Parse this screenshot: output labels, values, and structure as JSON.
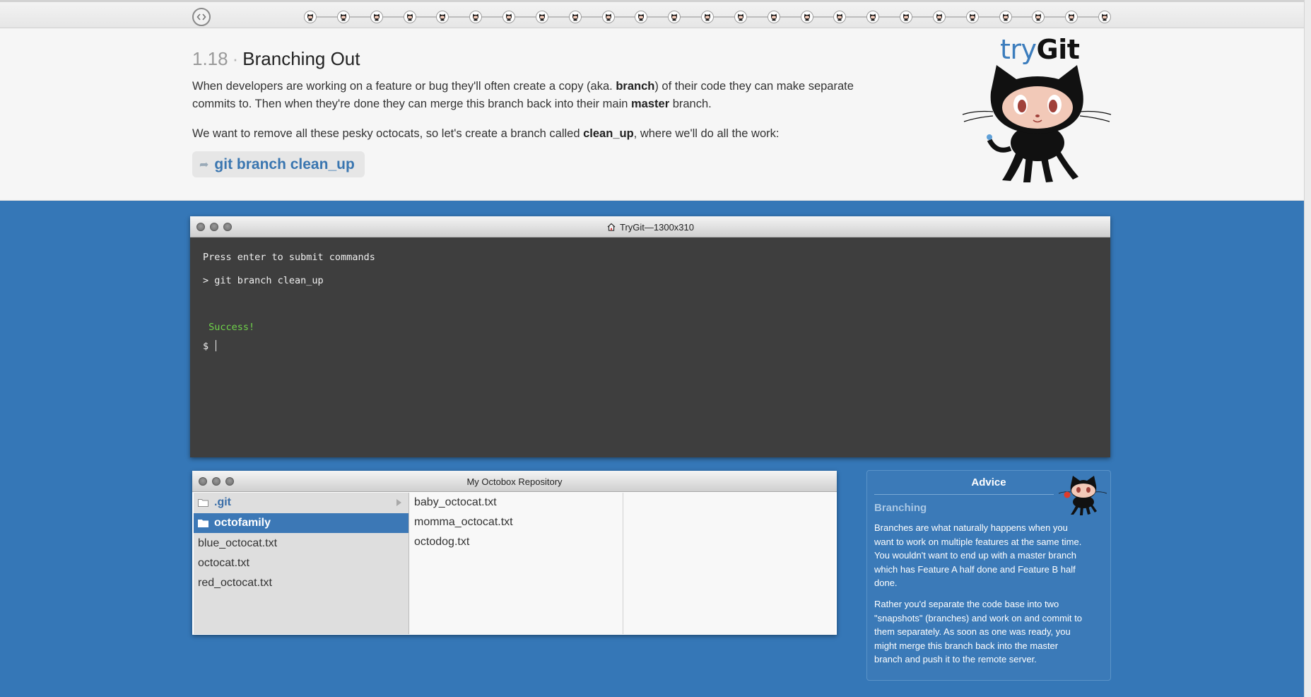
{
  "progress": {
    "total_steps": 25,
    "nav_icon": "code-brackets-icon",
    "step_icon": "octocat-icon"
  },
  "lesson": {
    "number": "1.18",
    "separator": "·",
    "title": "Branching Out",
    "para1": {
      "t1": "When developers are working on a feature or bug they'll often create a copy (aka. ",
      "b1": "branch",
      "t2": ") of their code they can make separate commits to. Then when they're done they can merge this branch back into their main ",
      "b2": "master",
      "t3": " branch."
    },
    "para2": {
      "t1": "We want to remove all these pesky octocats, so let's create a branch called ",
      "b1": "clean_up",
      "t2": ", where we'll do all the work:"
    },
    "command": "git branch clean_up"
  },
  "logo": {
    "try": "try",
    "git": "Git"
  },
  "terminal": {
    "title": "TryGit—1300x310",
    "lines": {
      "intro": "Press enter to submit commands",
      "command": "> git branch clean_up",
      "success": " Success!",
      "prompt": "$ "
    }
  },
  "repo": {
    "title": "My Octobox Repository",
    "col1": [
      {
        "name": ".git",
        "type": "folder"
      },
      {
        "name": "octofamily",
        "type": "folder",
        "selected": true
      },
      {
        "name": "blue_octocat.txt",
        "type": "file"
      },
      {
        "name": "octocat.txt",
        "type": "file"
      },
      {
        "name": "red_octocat.txt",
        "type": "file"
      }
    ],
    "col2": [
      "baby_octocat.txt",
      "momma_octocat.txt",
      "octodog.txt"
    ]
  },
  "advice": {
    "title": "Advice",
    "heading": "Branching",
    "p1": "Branches are what naturally happens when you want to work on multiple features at the same time. You wouldn't want to end up with a master branch which has Feature A half done and Feature B half done.",
    "p2": "Rather you'd separate the code base into two \"snapshots\" (branches) and work on and commit to them separately. As soon as one was ready, you might merge this branch back into the master branch and push it to the remote server."
  },
  "colors": {
    "main_blue": "#3577b7",
    "link_blue": "#3a76b0",
    "success_green": "#6fd34a",
    "terminal_bg": "#3e3e3e"
  }
}
